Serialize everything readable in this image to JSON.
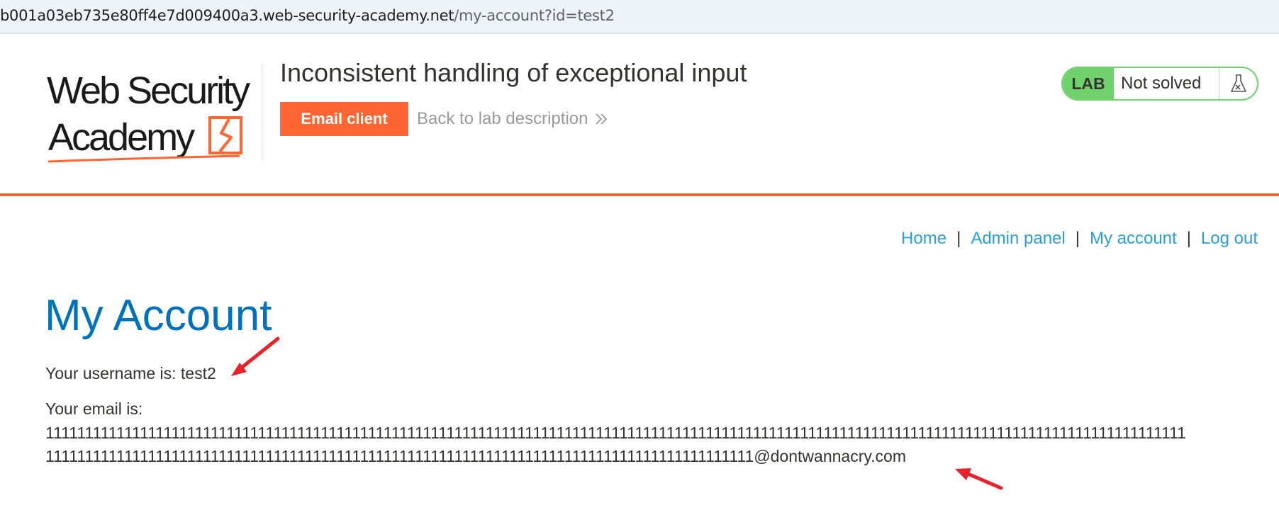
{
  "browser": {
    "url_host": "b001a03eb735e80ff4e7d009400a3.web-security-academy.net",
    "url_path": "/my-account?id=test2"
  },
  "header": {
    "logo_line1": "Web Security",
    "logo_line2": "Academy",
    "lab_title": "Inconsistent handling of exceptional input",
    "email_client_label": "Email client",
    "back_link_label": "Back to lab description",
    "status_badge": "LAB",
    "status_text": "Not solved",
    "accent_color": "#ff6633",
    "solved_badge_color": "#70d16d"
  },
  "nav": {
    "home": "Home",
    "admin_panel": "Admin panel",
    "my_account": "My account",
    "log_out": "Log out",
    "separator": "|"
  },
  "main": {
    "title": "My Account",
    "username_line": "Your username is: test2",
    "email_label": "Your email is:",
    "email_line1": "1111111111111111111111111111111111111111111111111111111111111111111111111111111111111111111111111111111111111111111111111111111111111111111111111",
    "email_line2": "111111111111111111111111111111111111111111111111111111111111111111111111111111111111111111@dontwannacry.com"
  },
  "icons": {
    "back_chevron": "double-chevron-right-icon",
    "flask": "flask-icon"
  }
}
